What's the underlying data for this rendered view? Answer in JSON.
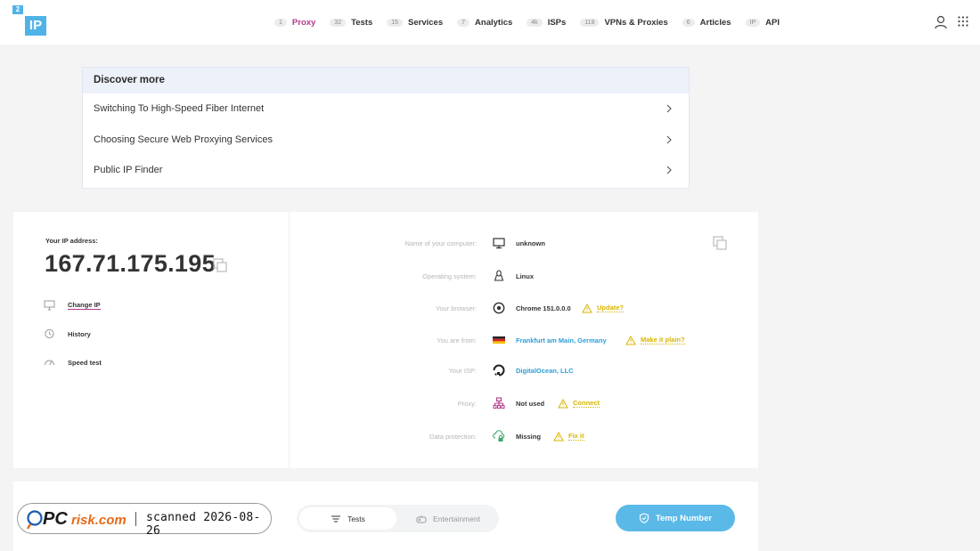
{
  "header": {
    "logo_small": "2",
    "logo_big": "IP",
    "nav": [
      {
        "count": "1",
        "label": "Proxy",
        "active": true
      },
      {
        "count": "32",
        "label": "Tests"
      },
      {
        "count": "15",
        "label": "Services"
      },
      {
        "count": "7",
        "label": "Analytics"
      },
      {
        "count": "4k",
        "label": "ISPs"
      },
      {
        "count": "118",
        "label": "VPNs & Proxies"
      },
      {
        "count": "6",
        "label": "Articles"
      },
      {
        "count": "IP",
        "label": "API"
      }
    ],
    "icons": [
      "user-icon",
      "grid-menu-icon"
    ]
  },
  "discover": {
    "title": "Discover more",
    "items": [
      {
        "label": "Switching To High-Speed Fiber Internet"
      },
      {
        "label": "Choosing Secure Web Proxying Services"
      },
      {
        "label": "Public IP Finder"
      }
    ]
  },
  "ip": {
    "label": "Your IP address:",
    "value": "167.71.175.195",
    "actions": [
      {
        "label": "Change IP",
        "icon": "monitor-icon"
      },
      {
        "label": "History",
        "icon": "history-icon"
      },
      {
        "label": "Speed test",
        "icon": "speed-icon"
      }
    ]
  },
  "info": [
    {
      "key": "Name of your computer:",
      "value": "unknown",
      "icon": "computer-icon"
    },
    {
      "key": "Operating system:",
      "value": "Linux",
      "icon": "linux-icon"
    },
    {
      "key": "Your browser:",
      "value": "Chrome 151.0.0.0",
      "icon": "chrome-icon",
      "warn": "Update?"
    },
    {
      "key": "You are from:",
      "value": "Frankfurt am Main, Germany",
      "icon": "germany-flag-icon",
      "warn": "Make it plain?"
    },
    {
      "key": "Your ISP:",
      "value": "DigitalOcean, LLC",
      "icon": "digitalocean-icon"
    },
    {
      "key": "Proxy:",
      "value": "Not used",
      "icon": "proxy-icon",
      "warn": "Connect"
    },
    {
      "key": "Data protection:",
      "value": "Missing",
      "icon": "cloud-lock-icon",
      "warn": "Fix it"
    }
  ],
  "bottom": {
    "tab_tests": "Tests",
    "tab_entertainment": "Entertainment",
    "temp_button": "Temp Number"
  },
  "watermark": {
    "text": "scanned 2026-08-26",
    "brand": "PCrisk.com"
  },
  "colors": {
    "accent": "#b03a8a",
    "link_blue": "#2b9fd8",
    "warn_yellow": "#d8b400",
    "button_blue": "#5bb9e8"
  }
}
